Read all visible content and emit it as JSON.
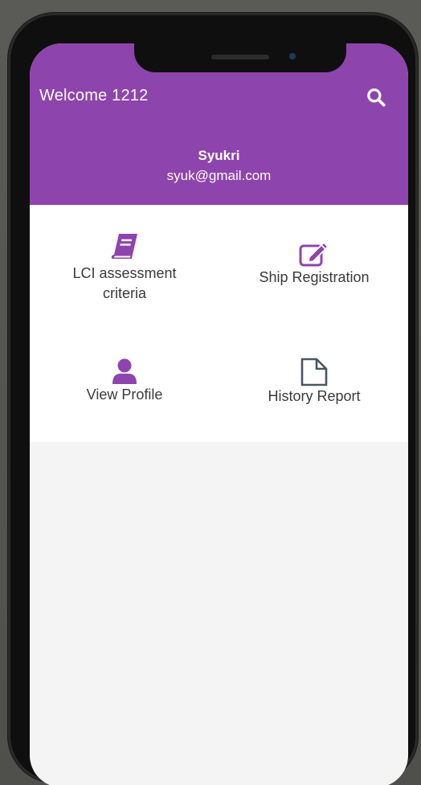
{
  "header": {
    "title": "Welcome 1212",
    "search_icon": "search-icon",
    "user_name": "Syukri",
    "user_email": "syuk@gmail.com"
  },
  "menu": {
    "items": [
      {
        "label": "LCI assessment criteria",
        "icon": "book-icon"
      },
      {
        "label": "Ship Registration",
        "icon": "edit-icon"
      },
      {
        "label": "View Profile",
        "icon": "user-icon"
      },
      {
        "label": "History Report",
        "icon": "file-icon"
      }
    ]
  },
  "colors": {
    "primary": "#8e44ad",
    "icon_dark": "#4a5660",
    "background": "#f4f4f4"
  }
}
